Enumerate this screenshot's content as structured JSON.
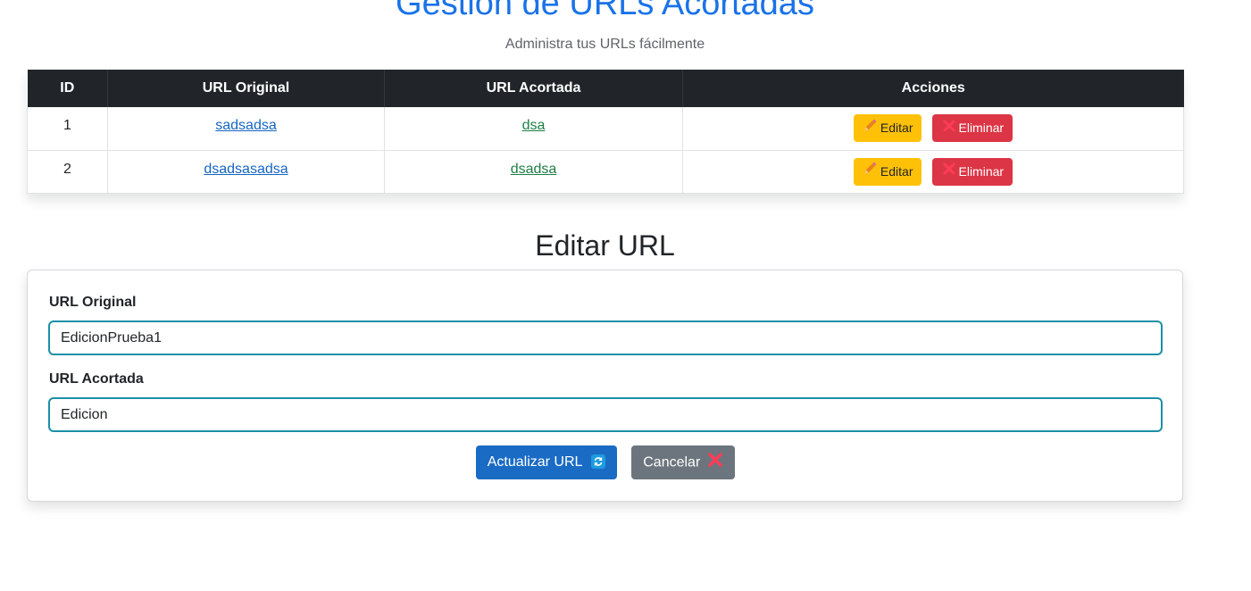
{
  "header": {
    "title": "Gestión de URLs Acortadas",
    "subtitle": "Administra tus URLs fácilmente"
  },
  "table": {
    "columns": [
      "ID",
      "URL Original",
      "URL Acortada",
      "Acciones"
    ],
    "rows": [
      {
        "id": "1",
        "original": "sadsadsa",
        "short": "dsa"
      },
      {
        "id": "2",
        "original": "dsadsasadsa",
        "short": "dsadsa"
      }
    ],
    "edit_label": "Editar",
    "delete_label": "Eliminar"
  },
  "edit_form": {
    "title": "Editar URL",
    "original_label": "URL Original",
    "original_value": "EdicionPrueba1",
    "short_label": "URL Acortada",
    "short_value": "Edicion",
    "update_label": "Actualizar URL",
    "cancel_label": "Cancelar"
  },
  "icons": {
    "edit": "pencil-icon",
    "delete": "cross-icon",
    "update": "refresh-icon",
    "cancel": "cross-icon"
  },
  "colors": {
    "title": "#1a73e8",
    "table_header": "#212529",
    "edit_button": "#ffc107",
    "delete_button": "#dc3545",
    "update_button": "#1a6bc4",
    "cancel_button": "#6c757d",
    "input_border": "#1b8fa6"
  }
}
